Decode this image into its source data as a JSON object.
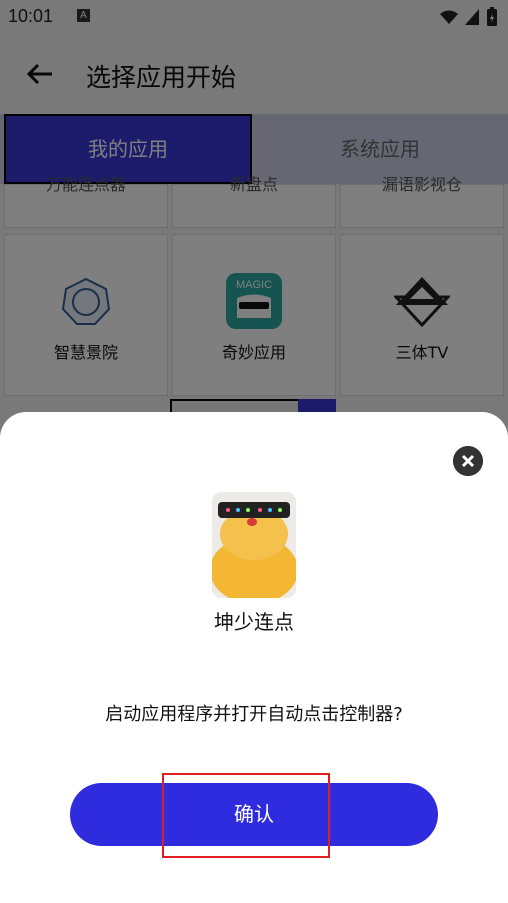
{
  "status": {
    "time": "10:01",
    "badge": "A"
  },
  "header": {
    "title": "选择应用开始"
  },
  "tabs": [
    {
      "label": "我的应用"
    },
    {
      "label": "系统应用"
    }
  ],
  "grid": {
    "row1": [
      "万能连点器",
      "新盘点",
      "漏语影视仓"
    ],
    "row2": [
      {
        "label": "智慧景院",
        "icon": "seal-icon"
      },
      {
        "label": "奇妙应用",
        "icon": "magic-icon"
      },
      {
        "label": "三体TV",
        "icon": "triangle-icon"
      }
    ]
  },
  "dialog": {
    "app_name": "坤少连点",
    "question": "启动应用程序并打开自动点击控制器?",
    "confirm_label": "确认"
  }
}
